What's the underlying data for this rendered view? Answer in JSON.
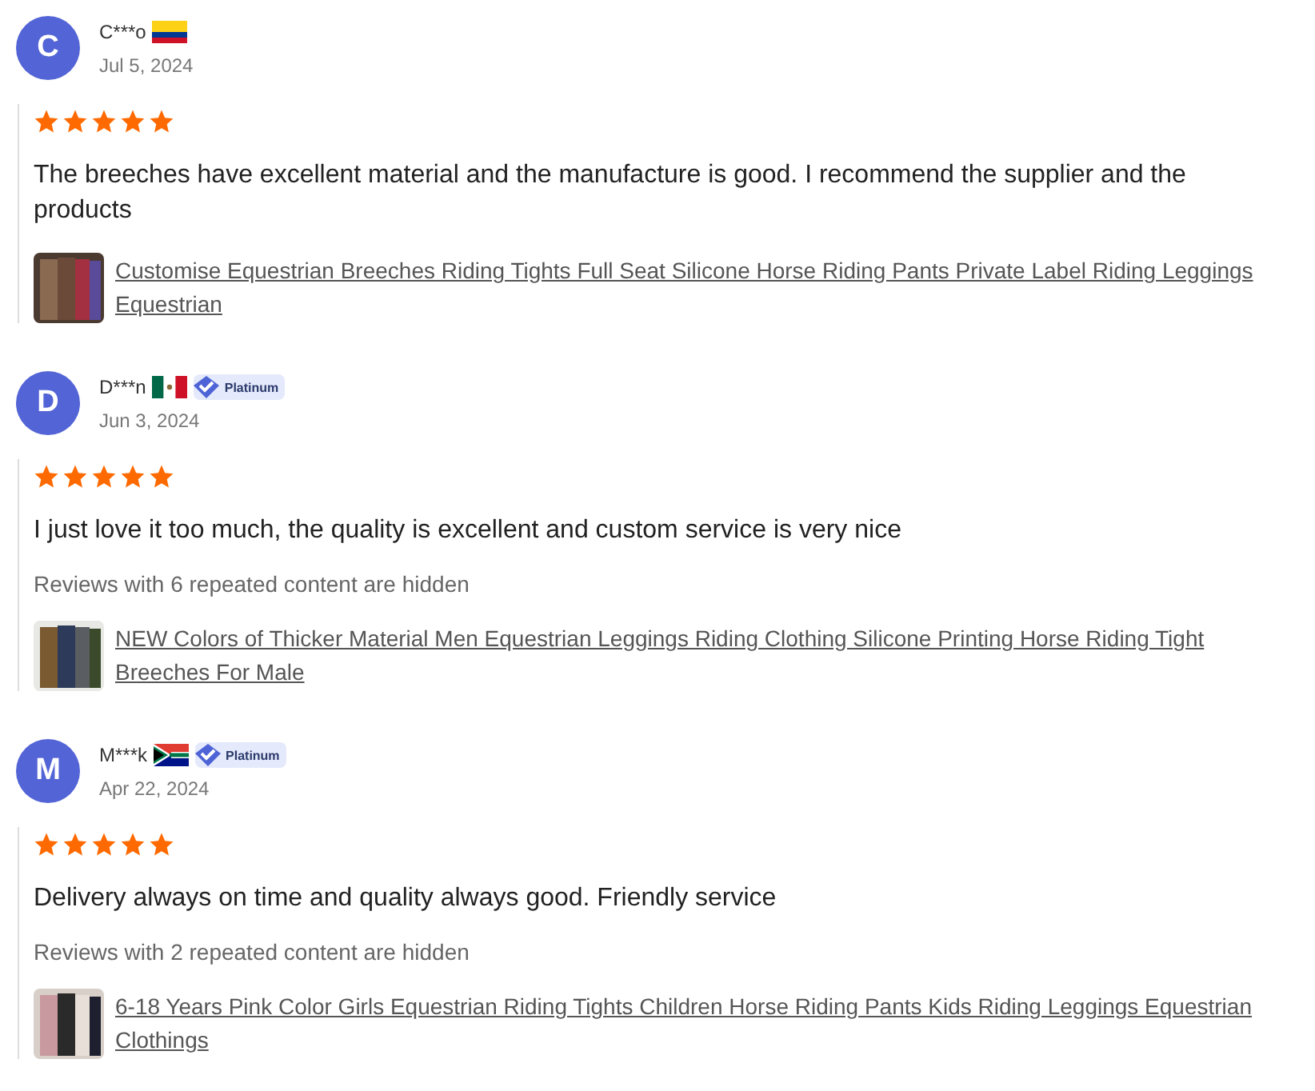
{
  "reviews": [
    {
      "initial": "C",
      "name": "C***o",
      "flag": {
        "kind": "colombia"
      },
      "date": "Jul 5, 2024",
      "stars": 5,
      "text": "The breeches have excellent material and the manufacture is good. I recommend the supplier and the products",
      "product": "Customise Equestrian Breeches Riding Tights Full Seat Silicone Horse Riding Pants Private Label Riding Leggings Equestrian"
    },
    {
      "initial": "D",
      "name": "D***n",
      "flag": {
        "kind": "mexico"
      },
      "badge": "Platinum",
      "date": "Jun 3, 2024",
      "stars": 5,
      "text": "I just love it too much, the quality is excellent and custom service is very nice",
      "hidden_note": "Reviews with 6 repeated content are hidden",
      "product": "NEW Colors of Thicker Material Men Equestrian Leggings Riding Clothing Silicone Printing Horse Riding Tight Breeches For Male"
    },
    {
      "initial": "M",
      "name": "M***k",
      "flag": {
        "kind": "south-africa"
      },
      "badge": "Platinum",
      "date": "Apr 22, 2024",
      "stars": 5,
      "text": "Delivery always on time and quality always good. Friendly service",
      "hidden_note": "Reviews with 2 repeated content are hidden",
      "product": "6-18 Years Pink Color Girls Equestrian Riding Tights Children Horse Riding Pants Kids Riding Leggings Equestrian Clothings"
    }
  ]
}
